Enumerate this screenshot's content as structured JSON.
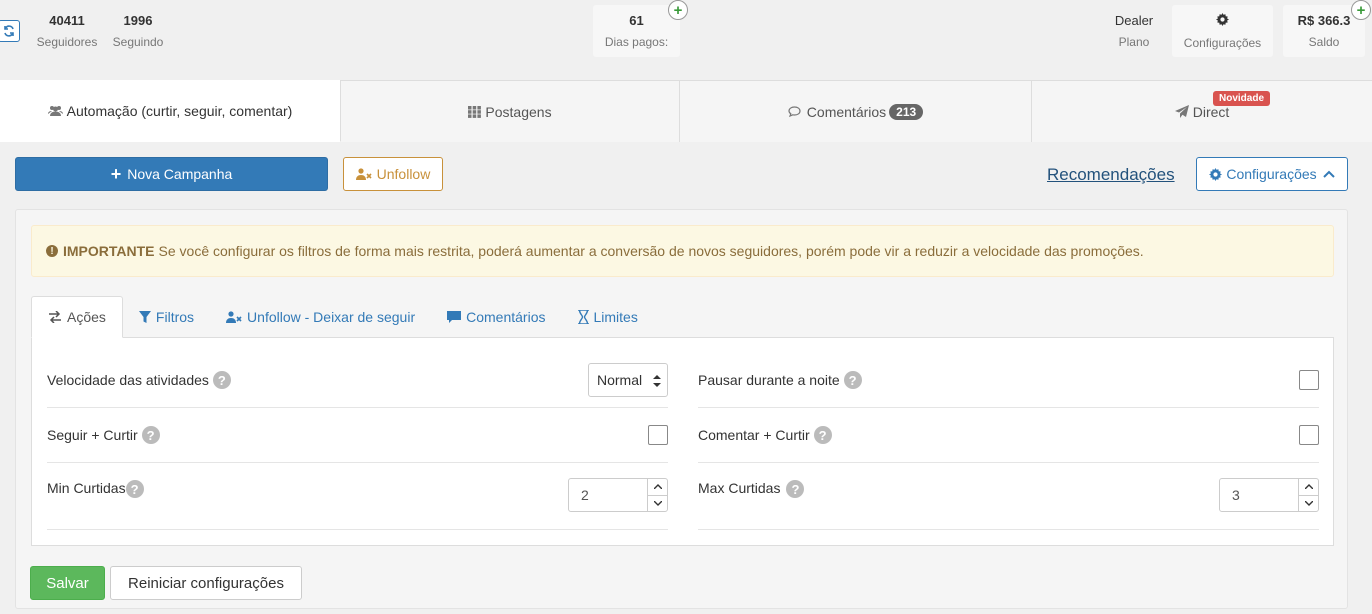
{
  "stats": {
    "followers": {
      "value": "40411",
      "label": "Seguidores"
    },
    "following": {
      "value": "1996",
      "label": "Seguindo"
    },
    "paid_days": {
      "value": "61",
      "label": "Dias pagos:"
    },
    "plan": {
      "value": "Dealer",
      "label": "Plano"
    },
    "settings": {
      "label": "Configurações"
    },
    "balance": {
      "value": "R$ 366.3",
      "label": "Saldo"
    }
  },
  "main_tabs": [
    {
      "label": "Automação (curtir, seguir, comentar)",
      "icon": "users-icon",
      "active": true
    },
    {
      "label": "Postagens",
      "icon": "grid-icon"
    },
    {
      "label": "Comentários",
      "icon": "comments-icon",
      "badge": "213"
    },
    {
      "label": "Direct",
      "icon": "paper-plane-icon",
      "flag": "Novidade"
    }
  ],
  "toolbar": {
    "new_campaign": "Nova Campanha",
    "unfollow": "Unfollow",
    "recommendations": "Recomendações",
    "settings": "Configurações"
  },
  "alert": {
    "strong": "IMPORTANTE",
    "text": "Se você configurar os filtros de forma mais restrita, poderá aumentar a conversão de novos seguidores, porém pode vir a reduzir a velocidade das promoções."
  },
  "sub_tabs": [
    {
      "label": "Ações",
      "icon": "exchange-icon",
      "active": true
    },
    {
      "label": "Filtros",
      "icon": "filter-icon"
    },
    {
      "label": "Unfollow - Deixar de seguir",
      "icon": "user-times-icon"
    },
    {
      "label": "Comentários",
      "icon": "comment-icon"
    },
    {
      "label": "Limites",
      "icon": "hourglass-icon"
    }
  ],
  "fields": {
    "speed": {
      "label": "Velocidade das atividades",
      "value": "Normal"
    },
    "pause_night": {
      "label": "Pausar durante a noite",
      "checked": false
    },
    "follow_like": {
      "label": "Seguir + Curtir",
      "checked": false
    },
    "comment_like": {
      "label": "Comentar + Curtir",
      "checked": false
    },
    "min_likes": {
      "label": "Min Curtidas",
      "value": "2"
    },
    "max_likes": {
      "label": "Max Curtidas",
      "value": "3"
    },
    "help": "?"
  },
  "actions": {
    "save": "Salvar",
    "reset": "Reiniciar configurações"
  },
  "colors": {
    "primary": "#337ab7",
    "success": "#5cb85c",
    "warning_text": "#8a6d3b",
    "warning_bg": "#fcf8e3",
    "unfollow": "#c8913b",
    "danger": "#d9534f"
  }
}
